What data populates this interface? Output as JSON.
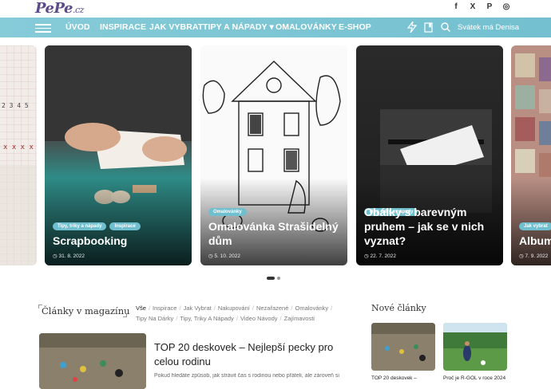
{
  "header": {
    "logo_main": "PePe",
    "logo_suffix": ".cz",
    "social": [
      {
        "icon": "facebook-icon",
        "glyph": "f"
      },
      {
        "icon": "x-icon",
        "glyph": "X"
      },
      {
        "icon": "pinterest-icon",
        "glyph": "P"
      },
      {
        "icon": "instagram-icon",
        "glyph": "◎"
      }
    ]
  },
  "nav": {
    "items": [
      "ÚVOD",
      "INSPIRACE",
      "JAK VYBRAT",
      "TIPY A NÁPADY",
      "OMALOVÁNKY",
      "E-SHOP"
    ],
    "dropdown_glyph": "▾",
    "svatek": "Svátek má Denisa",
    "accent": "#7ec8d6"
  },
  "slider": {
    "cards": [
      {
        "title": "",
        "date": "",
        "tags": []
      },
      {
        "title": "Scrapbooking",
        "date": "31. 8. 2022",
        "tags": [
          "Tipy, triky a nápady",
          "Inspirace"
        ]
      },
      {
        "title": "Omalovánka Strašidelný dům",
        "date": "5. 10. 2022",
        "tags": [
          "Omalovánky"
        ]
      },
      {
        "title": "Obálky s barevným pruhem – jak se v nich vyznat?",
        "date": "22. 7. 2022",
        "tags": [
          "Tipy, triky a nápady"
        ]
      },
      {
        "title": "Album",
        "date": "7. 9. 2022",
        "tags": [
          "Jak vybrat"
        ]
      }
    ]
  },
  "magazine": {
    "title": "Články v magazínu",
    "filters": [
      "Vše",
      "Inspirace",
      "Jak Vybrat",
      "Nakupování",
      "Nezařazené",
      "Omalovánky",
      "Tipy Na Dárky",
      "Tipy, Triky A Nápady",
      "Video Návody",
      "Zajímavosti"
    ],
    "article": {
      "title": "TOP 20 deskovek – Nejlepší pecky pro celou rodinu",
      "excerpt": "Pokud hledáte způsob, jak strávit čas s rodinou nebo přáteli, ale zároveň si"
    }
  },
  "sidebar": {
    "title": "Nové články",
    "items": [
      {
        "caption": "TOP 20 deskovek –"
      },
      {
        "caption": "Proč je R-GOL v roce 2024"
      }
    ]
  }
}
